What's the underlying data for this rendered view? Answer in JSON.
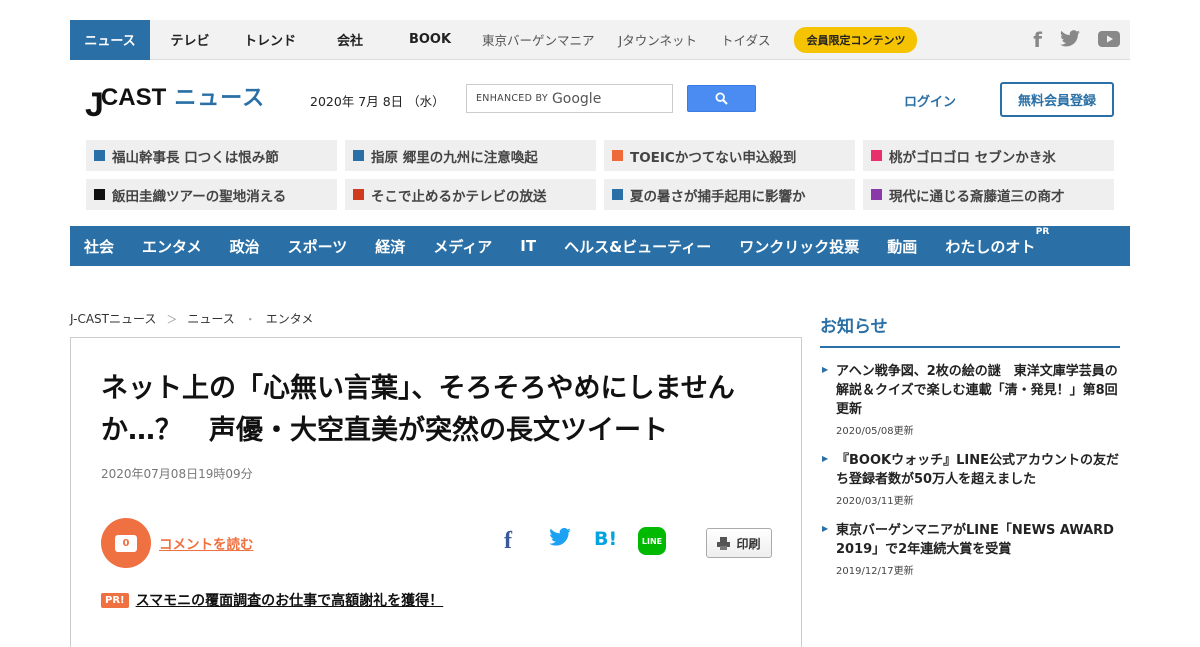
{
  "topnav": {
    "items": [
      "ニュース",
      "テレビ",
      "トレンド",
      "会社",
      "BOOK"
    ],
    "sub_items": [
      "東京バーゲンマニア",
      "Jタウンネット",
      "トイダス"
    ],
    "member_pill": "会員限定コンテンツ",
    "social_icons": [
      "facebook-icon",
      "twitter-icon",
      "youtube-icon"
    ]
  },
  "header": {
    "logo_j": "J",
    "logo_cast": "CAST",
    "logo_news": "ニュース",
    "date": "2020年 7月 8日 （水）",
    "search_enhanced": "ENHANCED BY",
    "search_google": "Google",
    "login": "ログイン",
    "register": "無料会員登録"
  },
  "trending": [
    {
      "text": "福山幹事長 口つくは恨み節",
      "color": "#2a6fa5"
    },
    {
      "text": "指原 郷里の九州に注意喚起",
      "color": "#2a6fa5"
    },
    {
      "text": "TOEICかつてない申込殺到",
      "color": "#ef6a3a"
    },
    {
      "text": "桃がゴロゴロ セブンかき氷",
      "color": "#e8306a"
    },
    {
      "text": "飯田圭織ツアーの聖地消える",
      "color": "#111111"
    },
    {
      "text": "そこで止めるかテレビの放送",
      "color": "#d03a1e"
    },
    {
      "text": "夏の暑さが捕手起用に影響か",
      "color": "#2a6fa5"
    },
    {
      "text": "現代に通じる斎藤道三の商才",
      "color": "#8a3aa8"
    }
  ],
  "categories": [
    "社会",
    "エンタメ",
    "政治",
    "スポーツ",
    "経済",
    "メディア",
    "IT",
    "ヘルス&ビューティー",
    "ワンクリック投票",
    "動画",
    "わたしのオト"
  ],
  "categories_pr": "PR",
  "breadcrumb": [
    "J-CASTニュース",
    "＞",
    "ニュース",
    "・",
    "エンタメ"
  ],
  "article": {
    "headline": "ネット上の「心無い言葉」、そろそろやめにしませんか…？　声優・大空直美が突然の長文ツイート",
    "published": "2020年07月08日19時09分",
    "comment_count": "0",
    "comment_link": "コメントを読む",
    "share_icons": [
      "facebook-icon",
      "twitter-icon",
      "hatena-bookmark-icon",
      "line-icon"
    ],
    "share_line_label": "LINE",
    "share_fb_glyph": "f",
    "share_tw_glyph": "🐦",
    "share_hb_glyph": "B!",
    "print_label": "印刷",
    "pr_badge": "PR!",
    "pr_text": "スマモニの覆面調査のお仕事で高額謝礼を獲得！"
  },
  "sidebar": {
    "title": "お知らせ",
    "items": [
      {
        "title": "アヘン戦争図、2枚の絵の謎　東洋文庫学芸員の解説＆クイズで楽しむ連載「清・発見！」第8回更新",
        "date": "2020/05/08更新"
      },
      {
        "title": "『BOOKウォッチ』LINE公式アカウントの友だち登録者数が50万人を超えました",
        "date": "2020/03/11更新"
      },
      {
        "title": "東京バーゲンマニアがLINE「NEWS AWARD 2019」で2年連続大賞を受賞",
        "date": "2019/12/17更新"
      }
    ]
  }
}
